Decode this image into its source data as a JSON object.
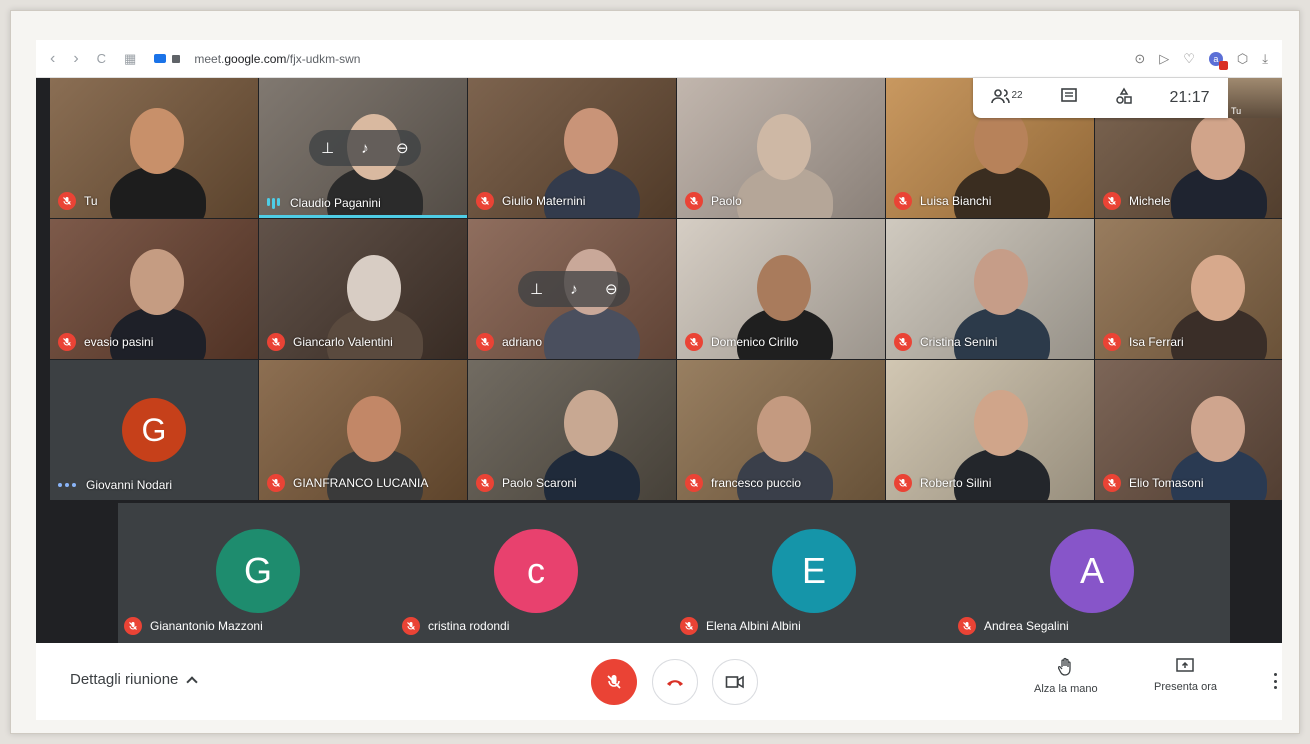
{
  "browser": {
    "url_prefix": "meet.",
    "url_domain": "google.com",
    "url_path": "/fjx-udkm-swn",
    "nav_back": "‹",
    "nav_forward": "›",
    "nav_reload": "C",
    "tabs_icon": "▦",
    "right_icons": [
      "camera-icon",
      "play-icon",
      "heart-icon",
      "profile-icon",
      "box-icon",
      "download-icon"
    ],
    "profile_letter": "a"
  },
  "info_panel": {
    "participants_count": "22",
    "time": "21:17"
  },
  "self_view": {
    "label": "Tu"
  },
  "tiles": [
    {
      "name": "Tu",
      "muted": true,
      "bg": "#7a5a3c",
      "skin": "#c8906a",
      "shirt": "#1d1d1d"
    },
    {
      "name": "Claudio Paganini",
      "muted": false,
      "speaking": true,
      "bg": "#6f665d",
      "skin": "#d9b9a0",
      "shirt": "#2b2b2b",
      "controls": true
    },
    {
      "name": "Giulio Maternini",
      "muted": true,
      "bg": "#6b4e36",
      "skin": "#c99478",
      "shirt": "#333b4c"
    },
    {
      "name": "Paolo",
      "muted": true,
      "bg": "#b9aca2",
      "skin": "#ceb8a5",
      "shirt": "#b5a698"
    },
    {
      "name": "Luisa Bianchi",
      "muted": true,
      "bg": "#c18a4a",
      "skin": "#b7825a",
      "shirt": "#3a2d20"
    },
    {
      "name": "Michele",
      "muted": true,
      "bg": "#6a503a",
      "skin": "#d1a48a",
      "shirt": "#1f2430"
    },
    {
      "name": "evasio pasini",
      "muted": true,
      "bg": "#6b4331",
      "skin": "#c59c82",
      "shirt": "#1e2028"
    },
    {
      "name": "Giancarlo Valentini",
      "muted": true,
      "bg": "#4b3a30",
      "skin": "#d8cdc4",
      "shirt": "#5a4a3e"
    },
    {
      "name": "adriano",
      "muted": true,
      "bg": "#805a48",
      "skin": "#c9a899",
      "shirt": "#4a4f5e",
      "controls": true
    },
    {
      "name": "Domenico Cirillo",
      "muted": true,
      "bg": "#d0c7bc",
      "skin": "#a97b5c",
      "shirt": "#1f1f1f"
    },
    {
      "name": "Cristina Senini",
      "muted": true,
      "bg": "#c9c2b6",
      "skin": "#c69d88",
      "shirt": "#2c3a4a"
    },
    {
      "name": "Isa Ferrari",
      "muted": true,
      "bg": "#8a6a48",
      "skin": "#d7a98c",
      "shirt": "#3a2e28"
    },
    {
      "name": "Giovanni Nodari",
      "muted": false,
      "connecting": true,
      "letter": "G",
      "color": "#c6401a",
      "bg": "#3c4043"
    },
    {
      "name": "GIANFRANCO LUCANIA",
      "muted": true,
      "bg": "#7d5b3a",
      "skin": "#c28767",
      "shirt": "#3a3a3a"
    },
    {
      "name": "Paolo Scaroni",
      "muted": true,
      "bg": "#5e574c",
      "skin": "#c8a892",
      "shirt": "#1f2a3a"
    },
    {
      "name": "francesco puccio",
      "muted": true,
      "bg": "#8a6d4b",
      "skin": "#c49a80",
      "shirt": "#3a3f4a"
    },
    {
      "name": "Roberto Silini",
      "muted": true,
      "bg": "#cbbfa8",
      "skin": "#d0a58a",
      "shirt": "#23262b"
    },
    {
      "name": "Elio Tomasoni",
      "muted": true,
      "bg": "#6a5040",
      "skin": "#cfa58e",
      "shirt": "#2a3a52"
    }
  ],
  "bottom_tiles": [
    {
      "name": "Gianantonio Mazzoni",
      "letter": "G",
      "color": "#1e8c6e"
    },
    {
      "name": "cristina rodondi",
      "letter": "c",
      "color": "#e8416e"
    },
    {
      "name": "Elena Albini Albini",
      "letter": "E",
      "color": "#1595a9"
    },
    {
      "name": "Andrea Segalini",
      "letter": "A",
      "color": "#8755c9"
    }
  ],
  "tile_controls": {
    "pin": "⊥",
    "mic": "🎙",
    "remove": "⊖"
  },
  "footer": {
    "details_label": "Dettagli riunione",
    "raise_hand_label": "Alza la mano",
    "present_label": "Presenta ora"
  },
  "colors": {
    "mute_red": "#ea4335",
    "speaking_blue": "#4ecde6",
    "brand_blue": "#1a73e8"
  }
}
